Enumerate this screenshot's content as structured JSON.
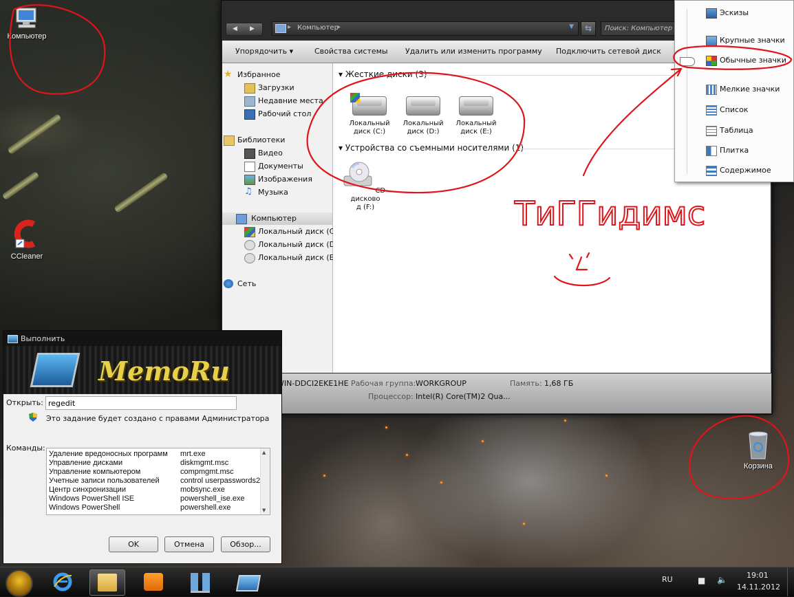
{
  "desktop": {
    "icons": [
      {
        "label": "Компьютер"
      },
      {
        "label": "CCleaner"
      },
      {
        "label": "Корзина"
      }
    ]
  },
  "explorer": {
    "address": {
      "path": "Компьютер"
    },
    "search_placeholder": "Поиск: Компьютер",
    "toolbar": {
      "organize": "Упорядочить",
      "system_properties": "Свойства системы",
      "uninstall": "Удалить или изменить программу",
      "map_drive": "Подключить сетевой диск"
    },
    "nav": {
      "favorites": "Избранное",
      "downloads": "Загрузки",
      "recent": "Недавние места",
      "desktop": "Рабочий стол",
      "libraries": "Библиотеки",
      "video": "Видео",
      "documents": "Документы",
      "images": "Изображения",
      "music": "Музыка",
      "computer": "Компьютер",
      "drive_c": "Локальный диск (C:)",
      "drive_d": "Локальный диск (D:)",
      "drive_e": "Локальный диск (E:)",
      "network": "Сеть"
    },
    "groups": {
      "hard_drives": "Жесткие диски (3)",
      "removable": "Устройства со съемными носителями (1)"
    },
    "drives": [
      {
        "line1": "Локальный",
        "line2": "диск (C:)"
      },
      {
        "line1": "Локальный",
        "line2": "диск (D:)"
      },
      {
        "line1": "Локальный",
        "line2": "диск (E:)"
      }
    ],
    "cd": {
      "line1": "CD-дисково",
      "line2": "д (F:)"
    },
    "details": {
      "computer_name": "WIN-DDCI2EKE1HE",
      "workgroup_label": "Рабочая группа:",
      "workgroup": "WORKGROUP",
      "memory_label": "Память:",
      "memory": "1,68 ГБ",
      "cpu_label": "Процессор:",
      "cpu": "Intel(R) Core(TM)2 Qua..."
    }
  },
  "view_menu": {
    "items": [
      {
        "label": "Эскизы"
      },
      {
        "label": "Крупные значки"
      },
      {
        "label": "Обычные значки"
      },
      {
        "label": "Мелкие значки"
      },
      {
        "label": "Список"
      },
      {
        "label": "Таблица"
      },
      {
        "label": "Плитка"
      },
      {
        "label": "Содержимое"
      }
    ],
    "selected": "Обычные значки"
  },
  "run_dialog": {
    "title": "Выполнить",
    "banner": "MemoRu",
    "open_label": "Открыть:",
    "open_value": "regedit",
    "admin_note": "Это задание будет создано с правами Администратора",
    "commands_label": "Команды:",
    "commands": [
      {
        "name": "Удаление вредоносных программ",
        "cmd": "mrt.exe"
      },
      {
        "name": "Управление дисками",
        "cmd": "diskmgmt.msc"
      },
      {
        "name": "Управление компьютером",
        "cmd": "compmgmt.msc"
      },
      {
        "name": "Учетные записи пользователей",
        "cmd": "control userpasswords2"
      },
      {
        "name": "Центр синхронизации",
        "cmd": "mobsync.exe"
      },
      {
        "name": "Windows PowerShell ISE",
        "cmd": "powershell_ise.exe"
      },
      {
        "name": "Windows PowerShell",
        "cmd": "powershell.exe"
      }
    ],
    "ok": "OK",
    "cancel": "Отмена",
    "browse": "Обзор..."
  },
  "taskbar": {
    "lang": "RU",
    "time": "19:01",
    "date": "14.11.2012"
  },
  "annotation": {
    "handwriting": "TиГГидимс"
  },
  "colors": {
    "annotation_red": "#e0141a",
    "explorer_dark": "#2b2b2b",
    "accent_blue": "#2b6fb3"
  }
}
